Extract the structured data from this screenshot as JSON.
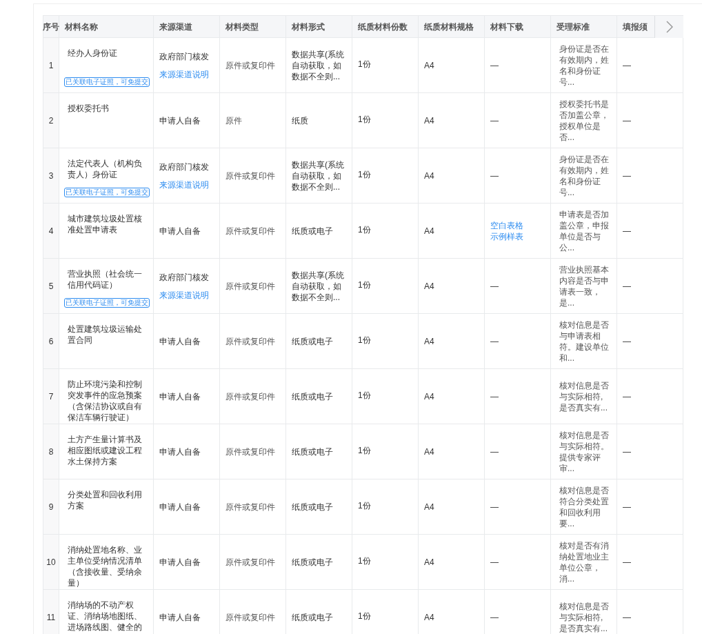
{
  "table": {
    "columns": [
      "序号",
      "材料名称",
      "来源渠道",
      "材料类型",
      "材料形式",
      "纸质材料份数",
      "纸质材料规格",
      "材料下载",
      "受理标准",
      "填报须"
    ],
    "rows": [
      {
        "index": "1",
        "name": "经办人身份证",
        "badge": "已关联电子证照，可免提交",
        "source": "政府部门核发",
        "source_link": "来源渠道说明",
        "type": "原件或复印件",
        "form": "数据共享(系统自动获取，如数据不全则...",
        "copies": "1份",
        "size": "A4",
        "download": {
          "kind": "text",
          "items": [
            "—"
          ]
        },
        "standard": "身份证是否在有效期内，姓名和身份证号...",
        "notes": "—"
      },
      {
        "index": "2",
        "name": "授权委托书",
        "source": "申请人自备",
        "type": "原件",
        "form": "纸质",
        "copies": "1份",
        "size": "A4",
        "download": {
          "kind": "text",
          "items": [
            "—"
          ]
        },
        "standard": "授权委托书是否加盖公章，授权单位是否...",
        "notes": "—"
      },
      {
        "index": "3",
        "name": "法定代表人（机构负责人）身份证",
        "badge": "已关联电子证照，可免提交",
        "source": "政府部门核发",
        "source_link": "来源渠道说明",
        "type": "原件或复印件",
        "form": "数据共享(系统自动获取，如数据不全则...",
        "copies": "1份",
        "size": "A4",
        "download": {
          "kind": "text",
          "items": [
            "—"
          ]
        },
        "standard": "身份证是否在有效期内，姓名和身份证号...",
        "notes": "—"
      },
      {
        "index": "4",
        "name": "城市建筑垃圾处置核准处置申请表",
        "source": "申请人自备",
        "type": "原件或复印件",
        "form": "纸质或电子",
        "copies": "1份",
        "size": "A4",
        "download": {
          "kind": "links",
          "items": [
            "空白表格",
            "示例样表"
          ]
        },
        "standard": "申请表是否加盖公章，申报单位是否与公...",
        "notes": "—"
      },
      {
        "index": "5",
        "name": "营业执照（社会统一信用代码证）",
        "badge": "已关联电子证照，可免提交",
        "source": "政府部门核发",
        "source_link": "来源渠道说明",
        "type": "原件或复印件",
        "form": "数据共享(系统自动获取，如数据不全则...",
        "copies": "1份",
        "size": "A4",
        "download": {
          "kind": "text",
          "items": [
            "—"
          ]
        },
        "standard": "营业执照基本内容是否与申请表一致，是...",
        "notes": "—"
      },
      {
        "index": "6",
        "name": "处置建筑垃圾运输处置合同",
        "source": "申请人自备",
        "type": "原件或复印件",
        "form": "纸质或电子",
        "copies": "1份",
        "size": "A4",
        "download": {
          "kind": "text",
          "items": [
            "—"
          ]
        },
        "standard": "核对信息是否与申请表相符。建设单位和...",
        "notes": "—"
      },
      {
        "index": "7",
        "name": "防止环境污染和控制突发事件的应急预案（含保洁协议或自有保洁车辆行驶证）",
        "source": "申请人自备",
        "type": "原件或复印件",
        "form": "纸质或电子",
        "copies": "1份",
        "size": "A4",
        "download": {
          "kind": "text",
          "items": [
            "—"
          ]
        },
        "standard": "核对信息是否与实际相符, 是否真实有...",
        "notes": "—"
      },
      {
        "index": "8",
        "name": "土方产生量计算书及相应图纸或建设工程水土保持方案",
        "source": "申请人自备",
        "type": "原件或复印件",
        "form": "纸质或电子",
        "copies": "1份",
        "size": "A4",
        "download": {
          "kind": "text",
          "items": [
            "—"
          ]
        },
        "standard": "核对信息是否与实际相符。提供专家评审...",
        "notes": "—"
      },
      {
        "index": "9",
        "name": "分类处置和回收利用方案",
        "source": "申请人自备",
        "type": "原件或复印件",
        "form": "纸质或电子",
        "copies": "1份",
        "size": "A4",
        "download": {
          "kind": "text",
          "items": [
            "—"
          ]
        },
        "standard": "核对信息是否符合分类处置和回收利用要...",
        "notes": "—"
      },
      {
        "index": "10",
        "name": "消纳处置地名称、业主单位受纳情况清单（含接收量、受纳余量）",
        "source": "申请人自备",
        "type": "原件或复印件",
        "form": "纸质或电子",
        "copies": "1份",
        "size": "A4",
        "download": {
          "kind": "text",
          "items": [
            "—"
          ]
        },
        "standard": "核对是否有消纳处置地业主单位公章，消...",
        "notes": "—"
      },
      {
        "index": "11",
        "name": "消纳场的不动产权证、消纳场地图纸、进场路线图、健全的",
        "source": "申请人自备",
        "type": "原件或复印件",
        "form": "纸质或电子",
        "copies": "1份",
        "size": "A4",
        "download": {
          "kind": "text",
          "items": [
            "—"
          ]
        },
        "standard": "核对信息是否与实际相符, 是否真实有...",
        "notes": "—"
      }
    ]
  }
}
